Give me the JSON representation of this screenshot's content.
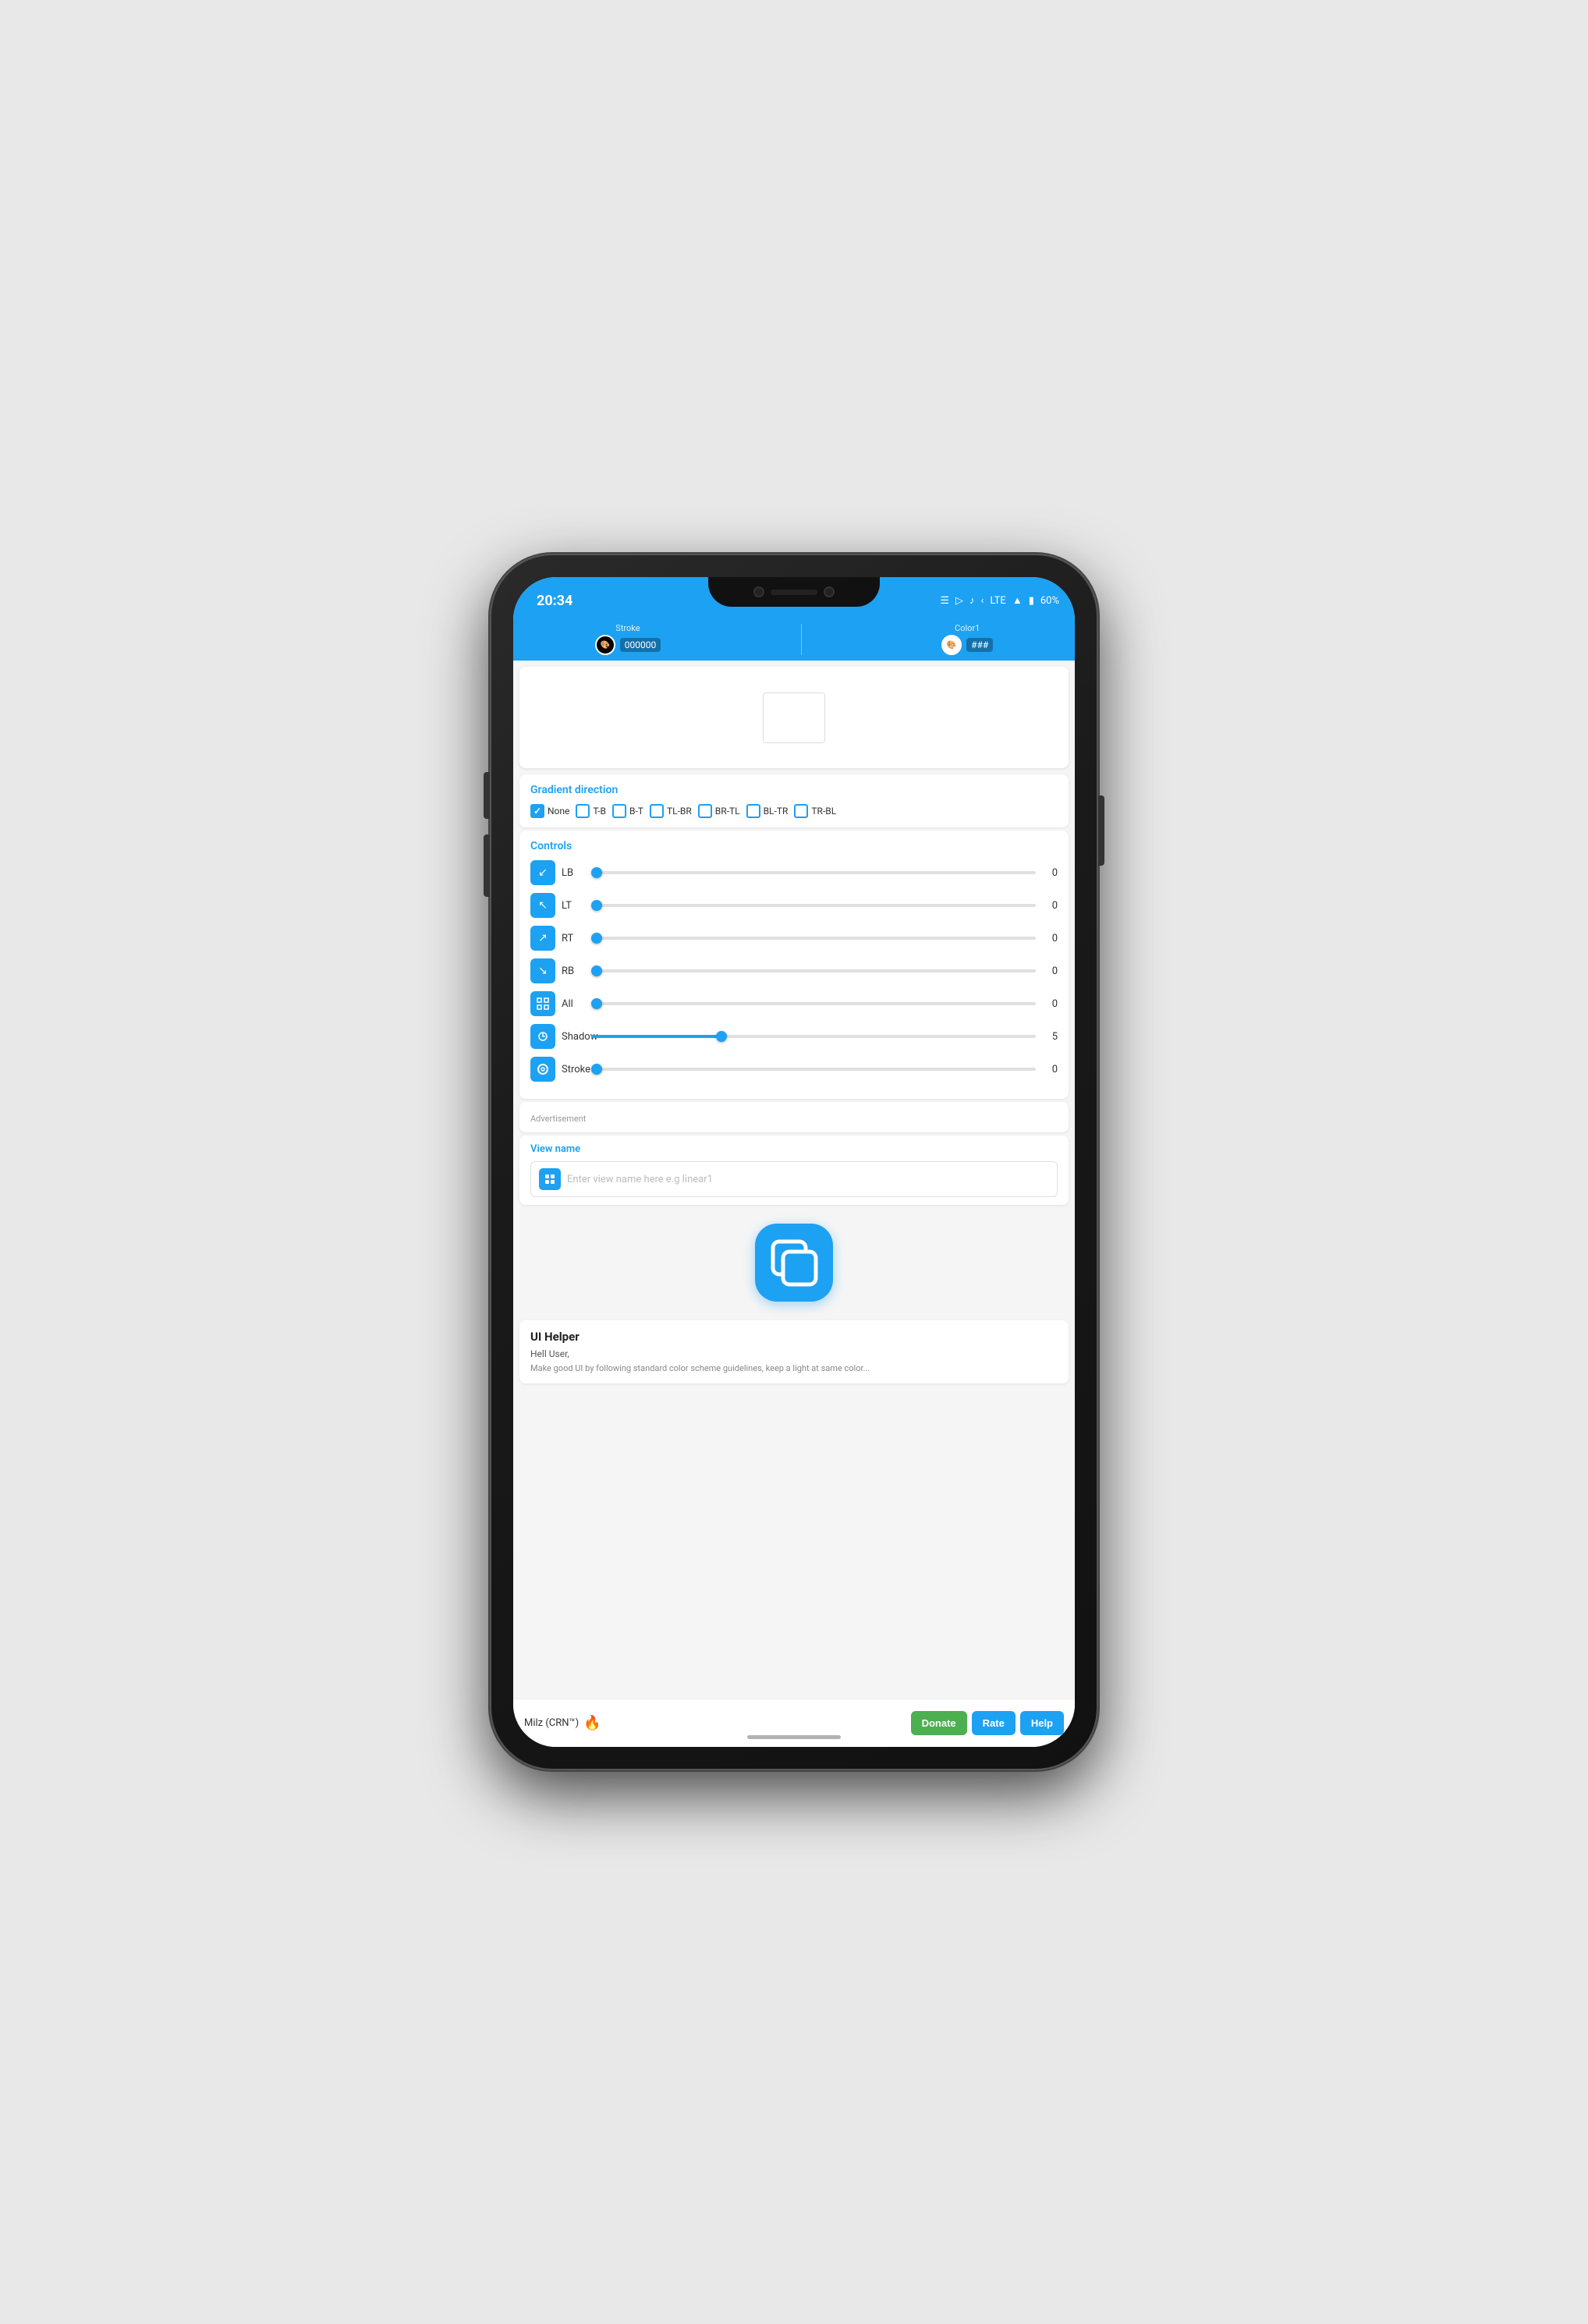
{
  "device": {
    "time": "20:34",
    "battery": "60%",
    "network": "LTE"
  },
  "toolbar": {
    "stroke_label": "Stroke",
    "stroke_color": "000000",
    "color1_label": "Color1",
    "color1_hex": "###"
  },
  "gradient": {
    "title": "Gradient direction",
    "options": [
      {
        "id": "none",
        "label": "None",
        "checked": true
      },
      {
        "id": "tb",
        "label": "T-B",
        "checked": false
      },
      {
        "id": "bt",
        "label": "B-T",
        "checked": false
      },
      {
        "id": "tlbr",
        "label": "TL-BR",
        "checked": false
      },
      {
        "id": "brtl",
        "label": "BR-TL",
        "checked": false
      },
      {
        "id": "bltr",
        "label": "BL-TR",
        "checked": false
      },
      {
        "id": "trbl",
        "label": "TR-BL",
        "checked": false
      }
    ]
  },
  "controls": {
    "title": "Controls",
    "items": [
      {
        "id": "lb",
        "label": "LB",
        "icon": "↙",
        "value": 0,
        "fillPct": 0
      },
      {
        "id": "lt",
        "label": "LT",
        "icon": "↖",
        "value": 0,
        "fillPct": 0
      },
      {
        "id": "rt",
        "label": "RT",
        "icon": "↗",
        "value": 0,
        "fillPct": 0
      },
      {
        "id": "rb",
        "label": "RB",
        "icon": "↘",
        "value": 0,
        "fillPct": 0
      },
      {
        "id": "all",
        "label": "All",
        "icon": "⊞",
        "value": 0,
        "fillPct": 0
      },
      {
        "id": "shadow",
        "label": "Shadow",
        "icon": "⚙",
        "value": 5,
        "fillPct": 30
      },
      {
        "id": "stroke",
        "label": "Stroke",
        "icon": "◎",
        "value": 0,
        "fillPct": 0
      }
    ]
  },
  "advertisement": {
    "label": "Advertisement"
  },
  "view_name": {
    "label": "View name",
    "placeholder": "Enter view name here e.g linear1"
  },
  "app": {
    "name": "UI Helper"
  },
  "ui_helper": {
    "title": "UI Helper",
    "greeting": "Hell User,",
    "description": "Make good UI by following standard color scheme guidelines, keep a light at same color..."
  },
  "bottom_bar": {
    "author": "Milz (CRN™)",
    "fire_emoji": "🔥",
    "donate_label": "Donate",
    "rate_label": "Rate",
    "help_label": "Help"
  }
}
